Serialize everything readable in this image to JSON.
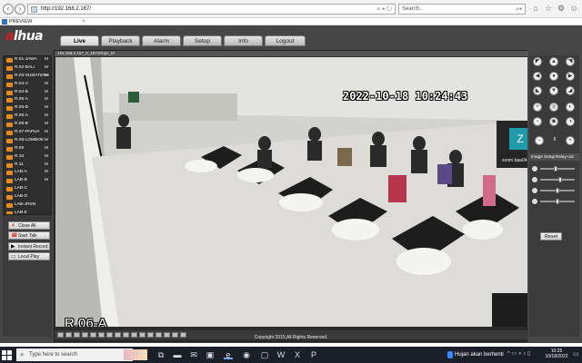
{
  "browser": {
    "url": "http://192.168.2.167/",
    "search_placeholder": "Search...",
    "tab_title": "PREVIEW",
    "icons": [
      "back-icon",
      "forward-icon",
      "search-icon",
      "refresh-icon",
      "home-icon",
      "star-icon",
      "gear-icon",
      "smiley-icon"
    ]
  },
  "app": {
    "logo_prefix": "a",
    "logo_text": "lhua",
    "menu": [
      {
        "label": "Live",
        "active": true
      },
      {
        "label": "Playback",
        "active": false
      },
      {
        "label": "Alarm",
        "active": false
      },
      {
        "label": "Setup",
        "active": false
      },
      {
        "label": "Info",
        "active": false
      },
      {
        "label": "Logout",
        "active": false
      }
    ],
    "cameras": [
      {
        "name": "R.01-JAWA",
        "flag": "M"
      },
      {
        "name": "R.02-BALI",
        "flag": "M"
      },
      {
        "name": "R.03-SUMATERA",
        "flag": "M"
      },
      {
        "name": "R.04-A",
        "flag": "M"
      },
      {
        "name": "R.04-B",
        "flag": "M"
      },
      {
        "name": "R.05-A",
        "flag": "M"
      },
      {
        "name": "R.05-B",
        "flag": "M"
      },
      {
        "name": "R.06-A",
        "flag": "M"
      },
      {
        "name": "R.06-B",
        "flag": "M"
      },
      {
        "name": "R.07-PAPUA",
        "flag": "M"
      },
      {
        "name": "R.08-LOMBOK",
        "flag": "M"
      },
      {
        "name": "R.09",
        "flag": "M"
      },
      {
        "name": "R.10",
        "flag": "M"
      },
      {
        "name": "R.11",
        "flag": "M"
      },
      {
        "name": "LAB-A",
        "flag": "M"
      },
      {
        "name": "LAB-B",
        "flag": "M"
      },
      {
        "name": "LAB-C",
        "flag": ""
      },
      {
        "name": "LAB-D",
        "flag": ""
      },
      {
        "name": "LAB-JRSN",
        "flag": ""
      },
      {
        "name": "LAB-E",
        "flag": ""
      }
    ],
    "side_buttons": [
      "Close All",
      "Start Talk",
      "Instant Record",
      "Local Play"
    ],
    "video": {
      "header": "192.168.2.167_0_1871Kbps_M",
      "timestamp": "2022-10-18 10:24:43",
      "camera_name": "R.06-A",
      "zoom_initial": "Z",
      "zoom_name": "zoom baa04"
    },
    "ptz": {
      "speed_value": "5",
      "image_setup_label": "Image Setup",
      "relay_label": "Relay-out",
      "reset_label": "Reset",
      "slider_levels": [
        0.45,
        0.6,
        0.5,
        0.5
      ]
    },
    "copyright": "Copyright 2015,All Rights Reserved."
  },
  "taskbar": {
    "search_placeholder": "Type here to search",
    "weather": "Hujan akan berhenti",
    "time": "10:25",
    "date": "10/18/2022"
  }
}
